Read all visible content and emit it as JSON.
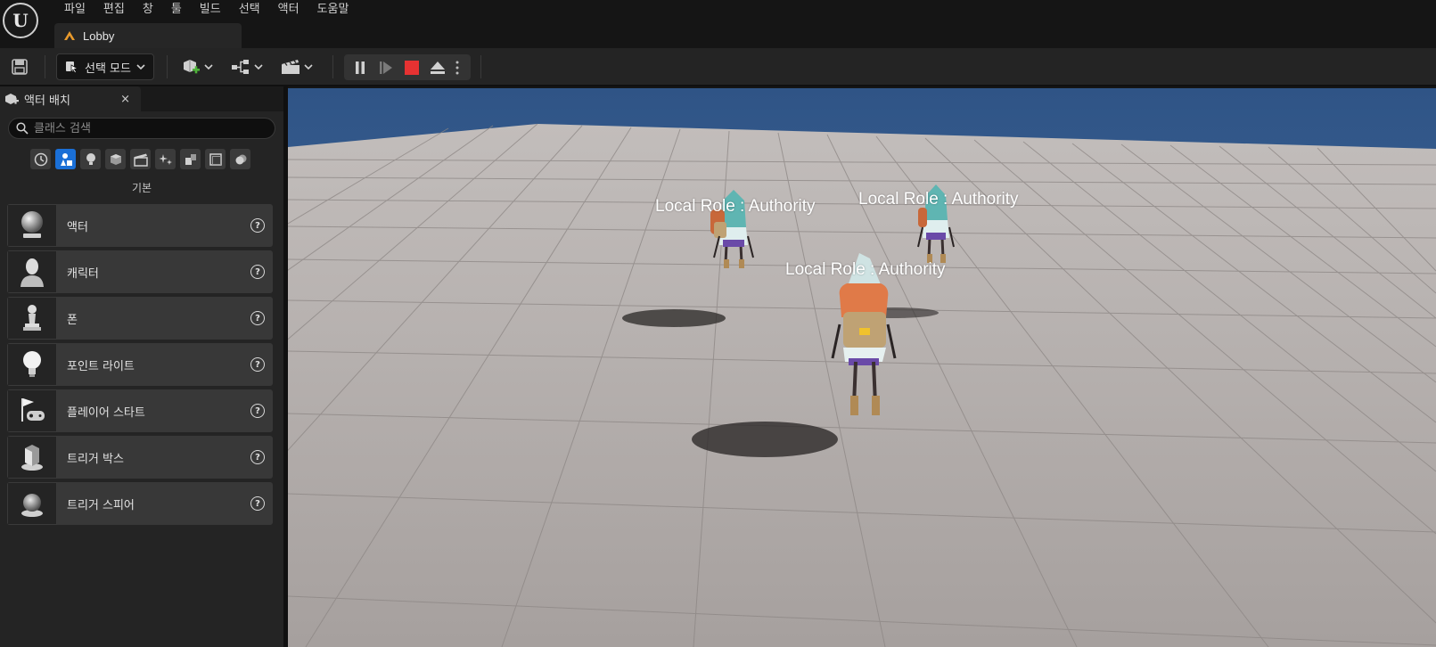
{
  "menu": [
    "파일",
    "편집",
    "창",
    "툴",
    "빌드",
    "선택",
    "액터",
    "도움말"
  ],
  "logo_icon": "unreal-engine-logo-icon",
  "tab": {
    "label": "Lobby",
    "icon": "level-icon"
  },
  "toolbar": {
    "mode_label": "선택 모드",
    "icons": [
      "save-icon",
      "add-actor-icon",
      "blueprint-icon",
      "cinematics-icon",
      "pause-icon",
      "step-icon",
      "stop-icon",
      "eject-icon",
      "more-icon"
    ],
    "colors": {
      "stop": "#e63232",
      "add": "#4fb33a"
    }
  },
  "place_actors": {
    "tab_label": "액터 배치",
    "close": "×",
    "search_placeholder": "클래스 검색",
    "section": "기본",
    "items": [
      {
        "label": "액터",
        "icon": "sphere-actor-icon"
      },
      {
        "label": "캐릭터",
        "icon": "character-icon"
      },
      {
        "label": "폰",
        "icon": "pawn-icon"
      },
      {
        "label": "포인트 라이트",
        "icon": "light-bulb-icon"
      },
      {
        "label": "플레이어 스타트",
        "icon": "player-start-icon"
      },
      {
        "label": "트리거 박스",
        "icon": "trigger-box-icon"
      },
      {
        "label": "트리거 스피어",
        "icon": "trigger-sphere-icon"
      }
    ],
    "help_glyph": "?"
  },
  "viewport": {
    "labels": [
      "Local Role : Authority",
      "Local Role : Authority",
      "Local Role : Authority"
    ],
    "sky_color": "#3f6597",
    "floor_color": "#b4aeac"
  }
}
